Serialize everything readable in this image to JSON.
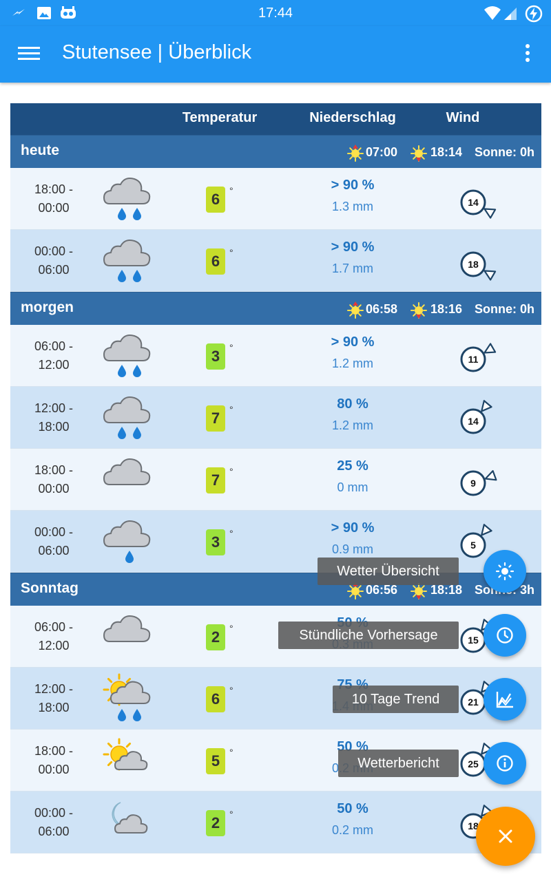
{
  "status_bar": {
    "time": "17:44"
  },
  "app_bar": {
    "title": "Stutensee | Überblick"
  },
  "table_header": {
    "temp": "Temperatur",
    "rain": "Niederschlag",
    "wind": "Wind"
  },
  "days": [
    {
      "name": "heute",
      "sunrise": "07:00",
      "sunset": "18:14",
      "sun_hours": "Sonne: 0h"
    },
    {
      "name": "morgen",
      "sunrise": "06:58",
      "sunset": "18:16",
      "sun_hours": "Sonne: 0h"
    },
    {
      "name": "Sonntag",
      "sunrise": "06:56",
      "sunset": "18:18",
      "sun_hours": "Sonne: 3h"
    }
  ],
  "rows": [
    {
      "from": "18:00 -",
      "to": "00:00",
      "icon": "cloud-rain-icon",
      "temp": "6",
      "deg": "°",
      "temp_color": "#c6dd2a",
      "prob": "> 90 %",
      "amount": "1.3 mm",
      "wind_speed": "14",
      "wind_dir_deg": 120
    },
    {
      "from": "00:00 -",
      "to": "06:00",
      "icon": "cloud-rain-icon",
      "temp": "6",
      "deg": "°",
      "temp_color": "#c6dd2a",
      "prob": "> 90 %",
      "amount": "1.7 mm",
      "wind_speed": "18",
      "wind_dir_deg": 120
    },
    {
      "from": "06:00 -",
      "to": "12:00",
      "icon": "cloud-rain-icon",
      "temp": "3",
      "deg": "°",
      "temp_color": "#9be23c",
      "prob": "> 90 %",
      "amount": "1.2 mm",
      "wind_speed": "11",
      "wind_dir_deg": 60
    },
    {
      "from": "12:00 -",
      "to": "18:00",
      "icon": "cloud-rain-icon",
      "temp": "7",
      "deg": "°",
      "temp_color": "#c6dd2a",
      "prob": "80 %",
      "amount": "1.2 mm",
      "wind_speed": "14",
      "wind_dir_deg": 40
    },
    {
      "from": "18:00 -",
      "to": "00:00",
      "icon": "cloud-icon",
      "temp": "7",
      "deg": "°",
      "temp_color": "#c6dd2a",
      "prob": "25 %",
      "amount": "0 mm",
      "wind_speed": "9",
      "wind_dir_deg": 70
    },
    {
      "from": "00:00 -",
      "to": "06:00",
      "icon": "cloud-drizzle-icon",
      "temp": "3",
      "deg": "°",
      "temp_color": "#9be23c",
      "prob": "> 90 %",
      "amount": "0.9 mm",
      "wind_speed": "5",
      "wind_dir_deg": 40
    },
    {
      "from": "06:00 -",
      "to": "12:00",
      "icon": "cloud-icon",
      "temp": "2",
      "deg": "°",
      "temp_color": "#9be23c",
      "prob": "50 %",
      "amount": "0.3 mm",
      "wind_speed": "15",
      "wind_dir_deg": 40
    },
    {
      "from": "12:00 -",
      "to": "18:00",
      "icon": "sun-cloud-rain-icon",
      "temp": "6",
      "deg": "°",
      "temp_color": "#c6dd2a",
      "prob": "75 %",
      "amount": "1.4 mm",
      "wind_speed": "21",
      "wind_dir_deg": 40
    },
    {
      "from": "18:00 -",
      "to": "00:00",
      "icon": "sun-cloud-icon",
      "temp": "5",
      "deg": "°",
      "temp_color": "#c6dd2a",
      "prob": "50 %",
      "amount": "0.2 mm",
      "wind_speed": "25",
      "wind_dir_deg": 40
    },
    {
      "from": "00:00 -",
      "to": "06:00",
      "icon": "moon-cloud-icon",
      "temp": "2",
      "deg": "°",
      "temp_color": "#9be23c",
      "prob": "50 %",
      "amount": "0.2 mm",
      "wind_speed": "18",
      "wind_dir_deg": 40
    }
  ],
  "fab_menu": {
    "items": [
      {
        "label": "Wetter Übersicht",
        "icon": "sun-icon"
      },
      {
        "label": "Stündliche Vorhersage",
        "icon": "clock-icon"
      },
      {
        "label": "10 Tage Trend",
        "icon": "trend-chart-icon"
      },
      {
        "label": "Wetterbericht",
        "icon": "info-icon"
      }
    ],
    "close_icon": "close-icon"
  },
  "colors": {
    "primary": "#2196f3",
    "header": "#1e4f82",
    "day_header": "#336ea8",
    "row_light": "#eef5fc",
    "row_dark": "#cfe3f6",
    "accent": "#ff9800"
  }
}
